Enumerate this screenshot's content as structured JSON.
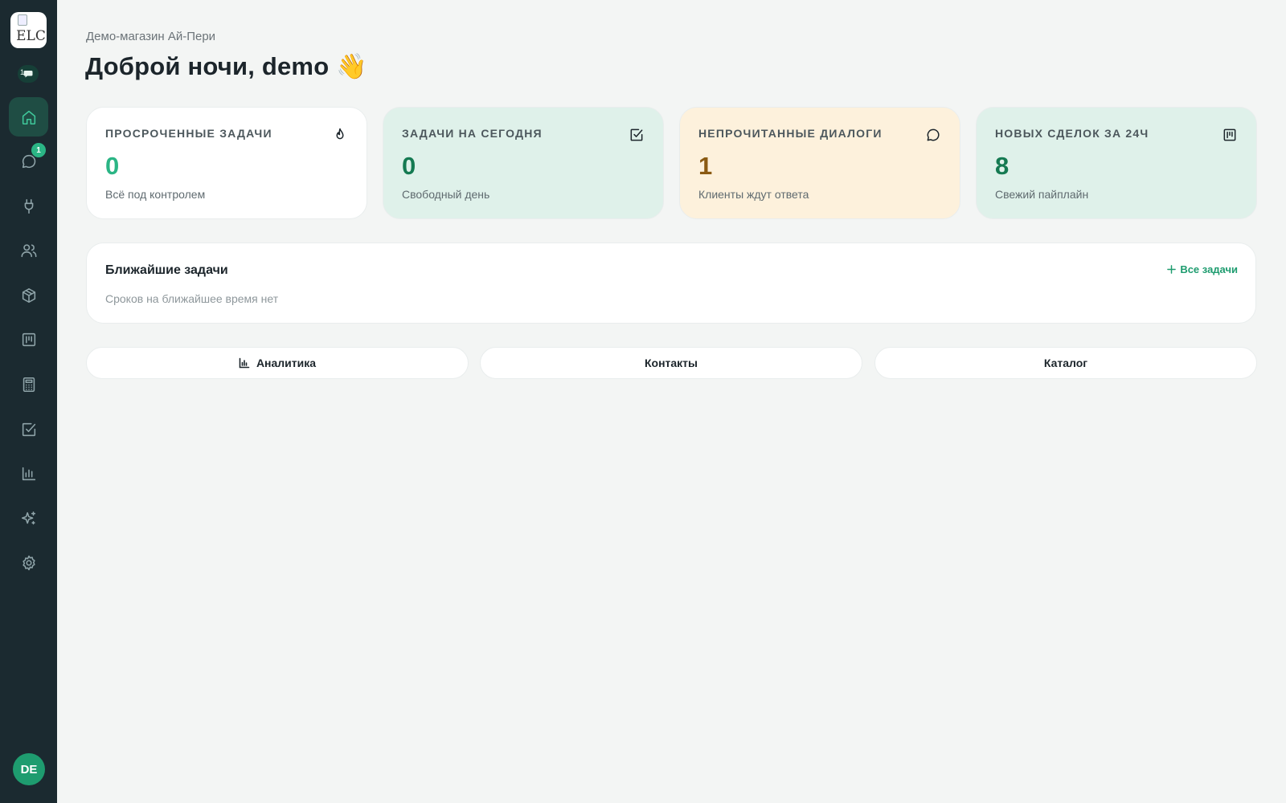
{
  "sidebar": {
    "logo_alt": "ELC",
    "chat_count": "1",
    "nav": [
      {
        "name": "home",
        "icon": "home-icon",
        "active": true
      },
      {
        "name": "chats",
        "icon": "chat-bubble-icon",
        "badge": "1"
      },
      {
        "name": "integrations",
        "icon": "plug-icon"
      },
      {
        "name": "contacts",
        "icon": "users-icon"
      },
      {
        "name": "products",
        "icon": "box-icon"
      },
      {
        "name": "kanban",
        "icon": "kanban-icon"
      },
      {
        "name": "calculator",
        "icon": "calculator-icon"
      },
      {
        "name": "tasks",
        "icon": "checkbox-icon"
      },
      {
        "name": "analytics",
        "icon": "bar-chart-icon"
      },
      {
        "name": "ai",
        "icon": "sparkles-icon"
      },
      {
        "name": "settings",
        "icon": "gear-icon"
      }
    ],
    "avatar_initials": "DE"
  },
  "header": {
    "store_name": "Демо-магазин Ай-Пери",
    "greeting": "Доброй ночи, demo 👋"
  },
  "cards": [
    {
      "label": "ПРОСРОЧЕННЫЕ ЗАДАЧИ",
      "value": "0",
      "sub": "Всё под контролем",
      "icon": "flame-icon",
      "bg": "#ffffff",
      "value_color": "#2bb585"
    },
    {
      "label": "ЗАДАЧИ НА СЕГОДНЯ",
      "value": "0",
      "sub": "Свободный день",
      "icon": "checkbox-icon",
      "bg": "#dff1ea",
      "value_color": "#157a52"
    },
    {
      "label": "НЕПРОЧИТАННЫЕ ДИАЛОГИ",
      "value": "1",
      "sub": "Клиенты ждут ответа",
      "icon": "chat-bubble-icon",
      "bg": "#fdf1dc",
      "value_color": "#8a5a12"
    },
    {
      "label": "НОВЫХ СДЕЛОК ЗА 24Ч",
      "value": "8",
      "sub": "Свежий пайплайн",
      "icon": "kanban-icon",
      "bg": "#dff1ea",
      "value_color": "#157a52"
    }
  ],
  "tasks": {
    "title": "Ближайшие задачи",
    "empty_text": "Сроков на ближайшее время нет",
    "all_link": "Все задачи"
  },
  "quick_links": {
    "analytics": "Аналитика",
    "contacts": "Контакты",
    "catalog": "Каталог"
  },
  "colors": {
    "sidebar_bg": "#1b2a30",
    "accent": "#1e9c6f",
    "page_bg": "#f3f5f4"
  }
}
